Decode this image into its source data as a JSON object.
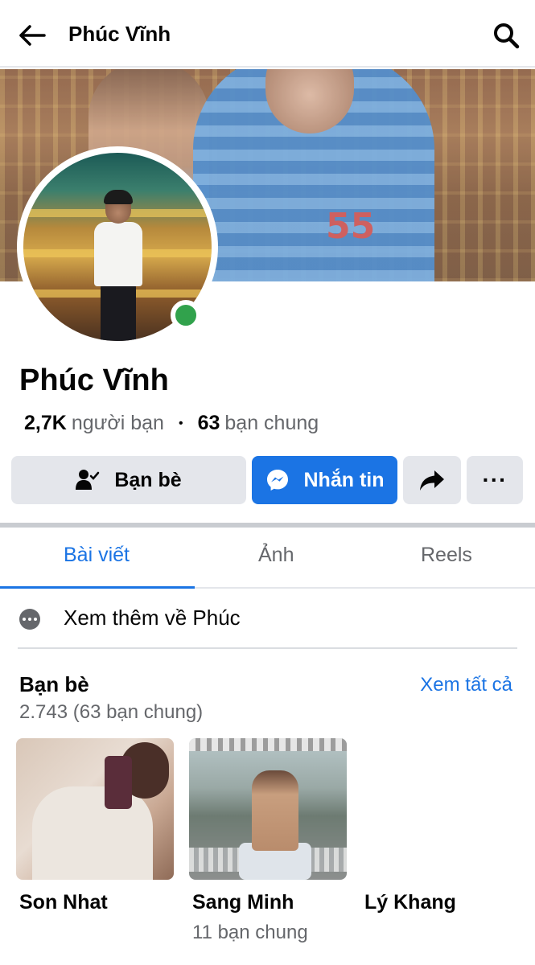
{
  "header": {
    "title": "Phúc Vĩnh"
  },
  "cover": {
    "jersey_number": "55"
  },
  "profile": {
    "name": "Phúc Vĩnh",
    "friends_count": "2,7K",
    "friends_label": "người bạn",
    "separator": "•",
    "mutual_count": "63",
    "mutual_label": "bạn chung",
    "online": true
  },
  "actions": {
    "friends_label": "Bạn bè",
    "message_label": "Nhắn tin",
    "more_label": "···"
  },
  "tabs": [
    {
      "label": "Bài viết",
      "active": true
    },
    {
      "label": "Ảnh",
      "active": false
    },
    {
      "label": "Reels",
      "active": false
    }
  ],
  "about": {
    "label": "Xem thêm về Phúc"
  },
  "friends_section": {
    "title": "Bạn bè",
    "see_all": "Xem tất cả",
    "count": "2.743 (63 bạn chung)",
    "friends": [
      {
        "name": "Son Nhat",
        "mutual": ""
      },
      {
        "name": "Sang Minh",
        "mutual": "11 bạn chung"
      },
      {
        "name": "Lý Khang",
        "mutual": ""
      }
    ]
  },
  "colors": {
    "accent": "#1b74e4",
    "online": "#31a24c",
    "secondary_text": "#65676b",
    "button_gray": "#e4e6eb"
  },
  "icons": [
    "arrow-left-icon",
    "search-icon",
    "friend-check-icon",
    "messenger-icon",
    "share-arrow-icon",
    "more-dots-icon",
    "info-dots-icon"
  ]
}
